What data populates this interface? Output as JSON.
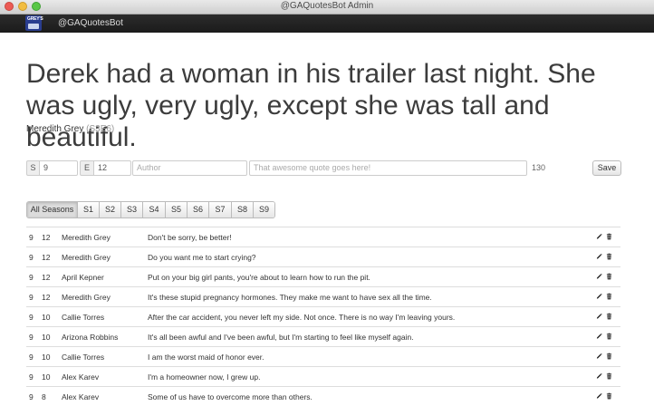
{
  "window": {
    "title": "@GAQuotesBot Admin"
  },
  "navbar": {
    "brand": "@GAQuotesBot",
    "logo_text": "GREY'S"
  },
  "hero": {
    "quote": "Derek had a woman in his trailer last night. She was ugly, very ugly, except she was tall and beautiful.",
    "author": "Meredith Grey",
    "episode": "(S3E6)"
  },
  "form": {
    "season_label": "S",
    "season_value": "9",
    "episode_label": "E",
    "episode_value": "12",
    "author_placeholder": "Author",
    "quote_placeholder": "That awesome quote goes here!",
    "char_count": "130",
    "save_label": "Save"
  },
  "season_filter": [
    "All Seasons",
    "S1",
    "S2",
    "S3",
    "S4",
    "S5",
    "S6",
    "S7",
    "S8",
    "S9"
  ],
  "season_filter_active": "All Seasons",
  "quotes": [
    {
      "season": "9",
      "episode": "12",
      "author": "Meredith Grey",
      "quote": "Don't be sorry, be better!"
    },
    {
      "season": "9",
      "episode": "12",
      "author": "Meredith Grey",
      "quote": "Do you want me to start crying?"
    },
    {
      "season": "9",
      "episode": "12",
      "author": "April Kepner",
      "quote": "Put on your big girl pants, you're about to learn how to run the pit."
    },
    {
      "season": "9",
      "episode": "12",
      "author": "Meredith Grey",
      "quote": "It's these stupid pregnancy hormones. They make me want to have sex all the time."
    },
    {
      "season": "9",
      "episode": "10",
      "author": "Callie Torres",
      "quote": "After the car accident, you never left my side. Not once. There is no way I'm leaving yours."
    },
    {
      "season": "9",
      "episode": "10",
      "author": "Arizona Robbins",
      "quote": "It's all been awful and I've been awful, but I'm starting to feel like myself again."
    },
    {
      "season": "9",
      "episode": "10",
      "author": "Callie Torres",
      "quote": "I am the worst maid of honor ever."
    },
    {
      "season": "9",
      "episode": "10",
      "author": "Alex Karev",
      "quote": "I'm a homeowner now, I grew up."
    },
    {
      "season": "9",
      "episode": "8",
      "author": "Alex Karev",
      "quote": "Some of us have to overcome more than others."
    }
  ],
  "icons": {
    "edit": "pencil-icon",
    "delete": "trash-icon"
  }
}
